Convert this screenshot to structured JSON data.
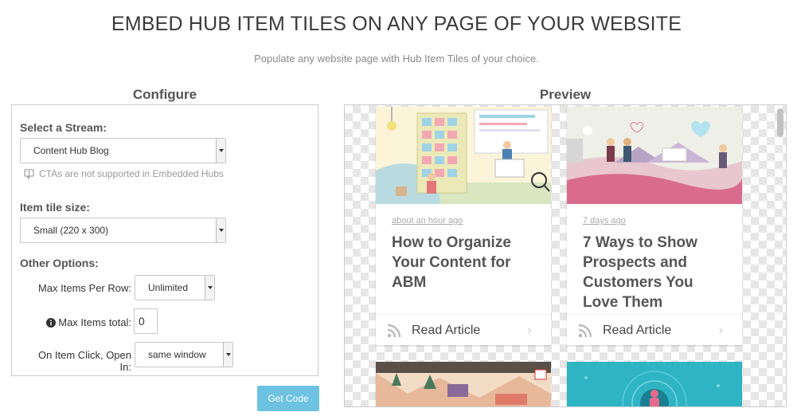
{
  "page": {
    "heading": "EMBED HUB ITEM TILES ON ANY PAGE OF YOUR WEBSITE",
    "subheading": "Populate any website page with Hub Item Tiles of your choice."
  },
  "configure": {
    "heading": "Configure",
    "stream_label": "Select a Stream:",
    "stream_value": "Content Hub Blog",
    "cta_note": "CTAs are not supported in Embedded Hubs",
    "tile_size_label": "Item tile size:",
    "tile_size_value": "Small (220 x 300)",
    "other_options_label": "Other Options:",
    "max_per_row_label": "Max Items Per Row:",
    "max_per_row_value": "Unlimited",
    "max_total_label": "Max Items total:",
    "max_total_value": "0",
    "open_in_label": "On Item Click, Open In:",
    "open_in_value": "same window",
    "get_code_label": "Get Code"
  },
  "preview": {
    "heading": "Preview",
    "tiles": [
      {
        "date": "about an hour ago",
        "title": "How to Organize Your Content for ABM",
        "link_label": "Read Article"
      },
      {
        "date": "7 days ago",
        "title": "7 Ways to Show Prospects and Customers You Love Them",
        "link_label": "Read Article"
      }
    ]
  },
  "colors": {
    "button_bg": "#6cc2e0",
    "text_dark": "#3a3a3a",
    "muted": "#999999"
  },
  "icons": [
    "info-icon",
    "cta-warning-icon",
    "rss-icon",
    "chevron-right-icon",
    "dropdown-arrow-icon"
  ]
}
